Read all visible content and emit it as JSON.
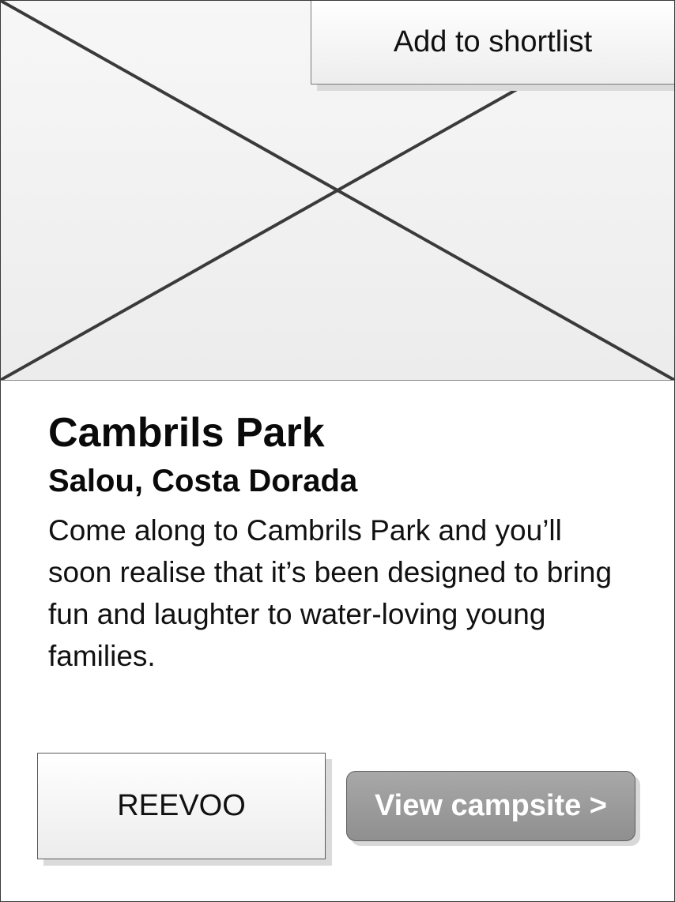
{
  "image": {
    "icon": "image-placeholder-icon"
  },
  "shortlist": {
    "label": "Add to shortlist"
  },
  "campsite": {
    "name": "Cambrils Park",
    "location": "Salou, Costa Dorada",
    "description": "Come along to Cambrils Park and you’ll soon realise that it’s been designed to bring fun and laughter to water-loving young families."
  },
  "actions": {
    "reevoo_label": "REEVOO",
    "view_label": "View campsite >"
  },
  "colors": {
    "primary_button": "#999999",
    "primary_button_text": "#ffffff",
    "border": "#3a3a3a"
  }
}
